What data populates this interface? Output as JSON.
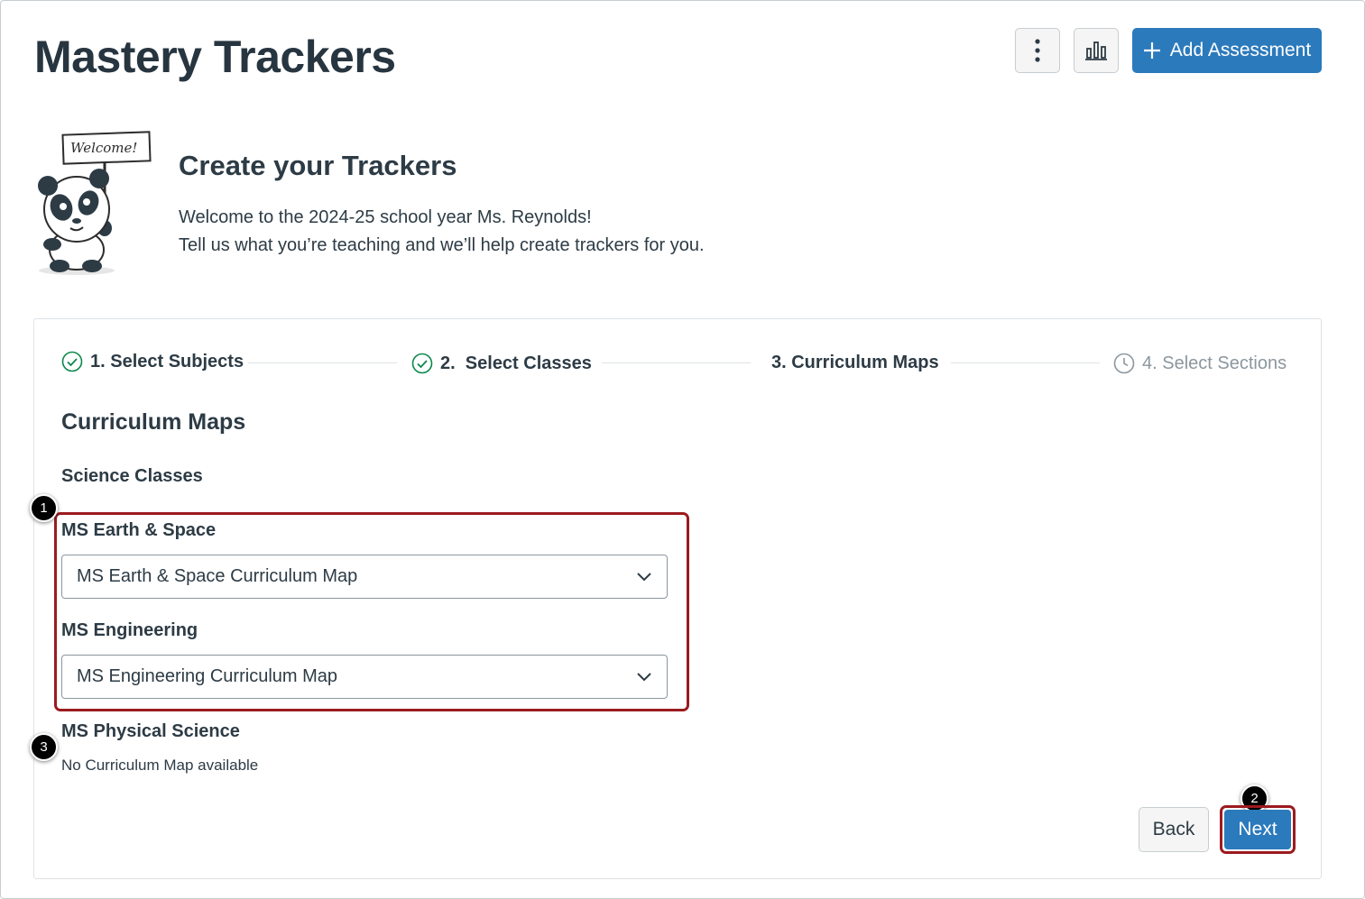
{
  "header": {
    "title": "Mastery Trackers",
    "more_icon": "vertical-dots-icon",
    "chart_icon": "bar-chart-icon",
    "add_button_label": "Add Assessment"
  },
  "welcome": {
    "sign_text": "Welcome!",
    "title": "Create your Trackers",
    "line1": "Welcome to the 2024-25 school year Ms. Reynolds!",
    "line2": "Tell us what you’re teaching and we’ll help create trackers for you."
  },
  "steps": [
    {
      "label": "1. Select Subjects",
      "status": "complete"
    },
    {
      "label": "2.  Select Classes",
      "status": "complete"
    },
    {
      "label": "3. Curriculum Maps",
      "status": "current"
    },
    {
      "label": "4. Select Sections",
      "status": "pending"
    }
  ],
  "main": {
    "section_title": "Curriculum Maps",
    "sub_title": "Science Classes",
    "classes": [
      {
        "label": "MS Earth & Space",
        "selected": "MS Earth & Space Curriculum Map"
      },
      {
        "label": "MS Engineering",
        "selected": "MS Engineering Curriculum Map"
      },
      {
        "label": "MS Physical Science",
        "note": "No Curriculum Map available"
      }
    ]
  },
  "callouts": [
    "1",
    "2",
    "3"
  ],
  "footer": {
    "back_label": "Back",
    "next_label": "Next"
  },
  "colors": {
    "primary": "#2b7abc",
    "highlight": "#9b1b1f",
    "success": "#0b874b",
    "muted": "#8b969e"
  }
}
